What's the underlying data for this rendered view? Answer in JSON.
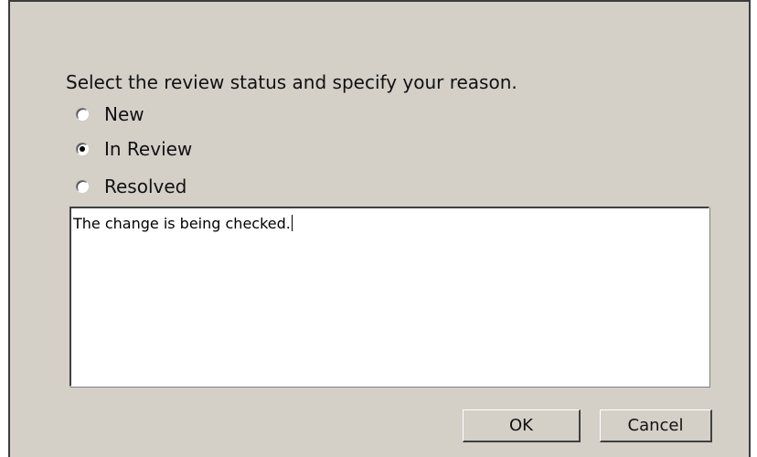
{
  "dialog": {
    "prompt": "Select the review status and specify your reason.",
    "status_options": [
      {
        "label": "New",
        "checked": false
      },
      {
        "label": "In Review",
        "checked": true
      },
      {
        "label": "Resolved",
        "checked": false
      }
    ],
    "reason_text": "The change is being checked.",
    "ok_label": "OK",
    "cancel_label": "Cancel"
  }
}
